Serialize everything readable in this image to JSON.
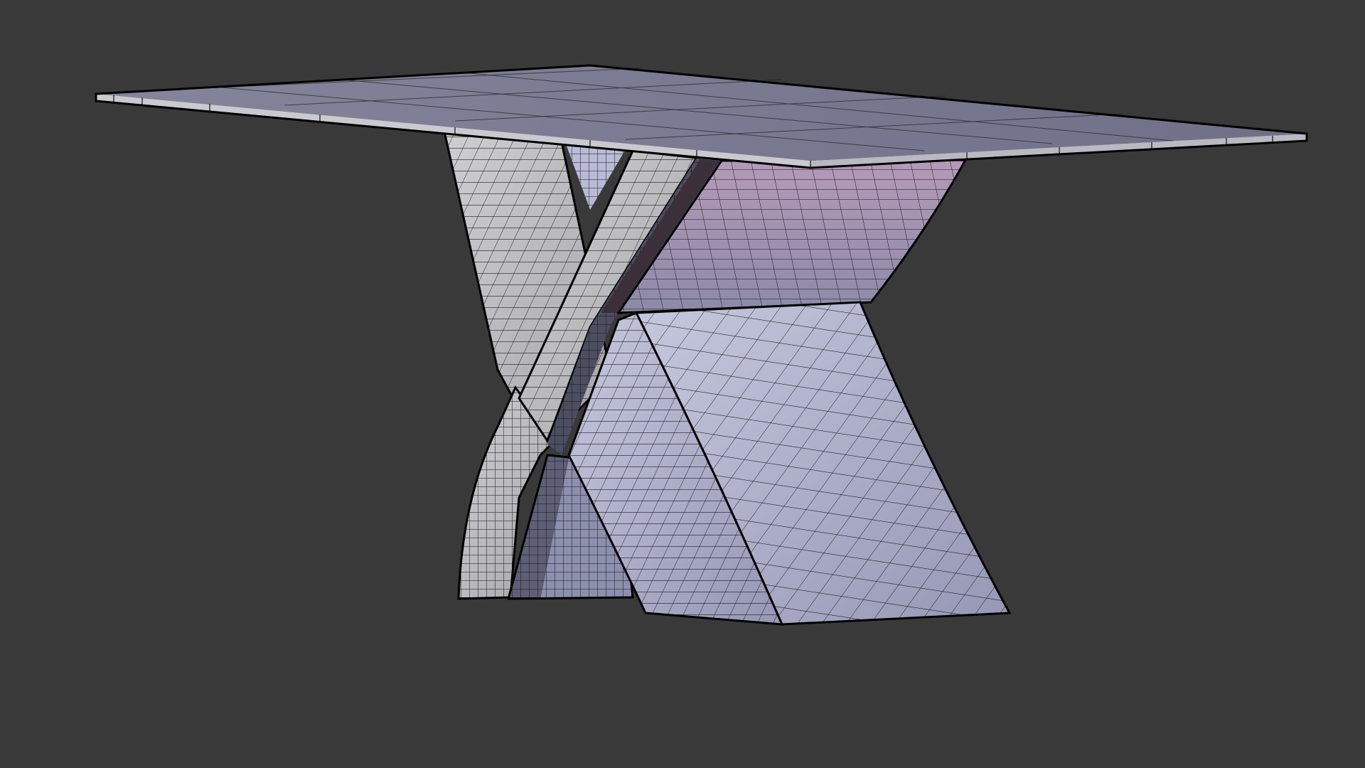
{
  "viewport": {
    "background_color": "#393939",
    "display_mode": "wireframe-on-shaded",
    "object": "table-with-x-base"
  },
  "colors": {
    "background": "#393939",
    "tabletop_surface": "#7f8097",
    "tabletop_edge": "#c9c9cf",
    "panel_light": "#bfbfc2",
    "panel_lavender": "#a6a7c2",
    "panel_pink": "#9a8aa4",
    "panel_dark": "#6f7190",
    "wire": "#000000"
  }
}
